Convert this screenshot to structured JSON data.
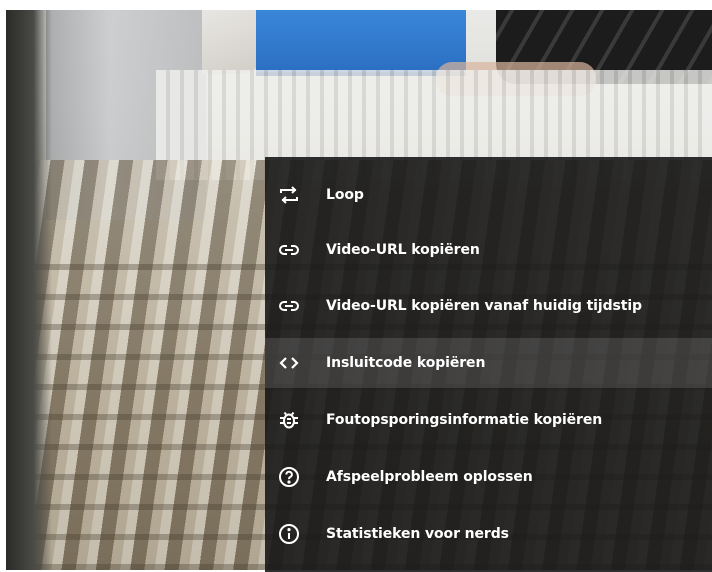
{
  "video": {
    "icons": [
      "video-frame"
    ]
  },
  "context_menu": {
    "hovered_index": 3,
    "items": [
      {
        "label": "Loop",
        "icon": "loop-icon"
      },
      {
        "label": "Video-URL kopiëren",
        "icon": "link-icon"
      },
      {
        "label": "Video-URL kopiëren vanaf huidig tijdstip",
        "icon": "link-icon"
      },
      {
        "label": "Insluitcode kopiëren",
        "icon": "embed-code-icon"
      },
      {
        "label": "Foutopsporingsinformatie kopiëren",
        "icon": "bug-icon"
      },
      {
        "label": "Afspeelprobleem oplossen",
        "icon": "help-circle-icon"
      },
      {
        "label": "Statistieken voor nerds",
        "icon": "info-circle-icon"
      }
    ]
  },
  "colors": {
    "menu_background": "#181818",
    "menu_text": "#ffffff",
    "hover_highlight": "#3a3a3a"
  }
}
